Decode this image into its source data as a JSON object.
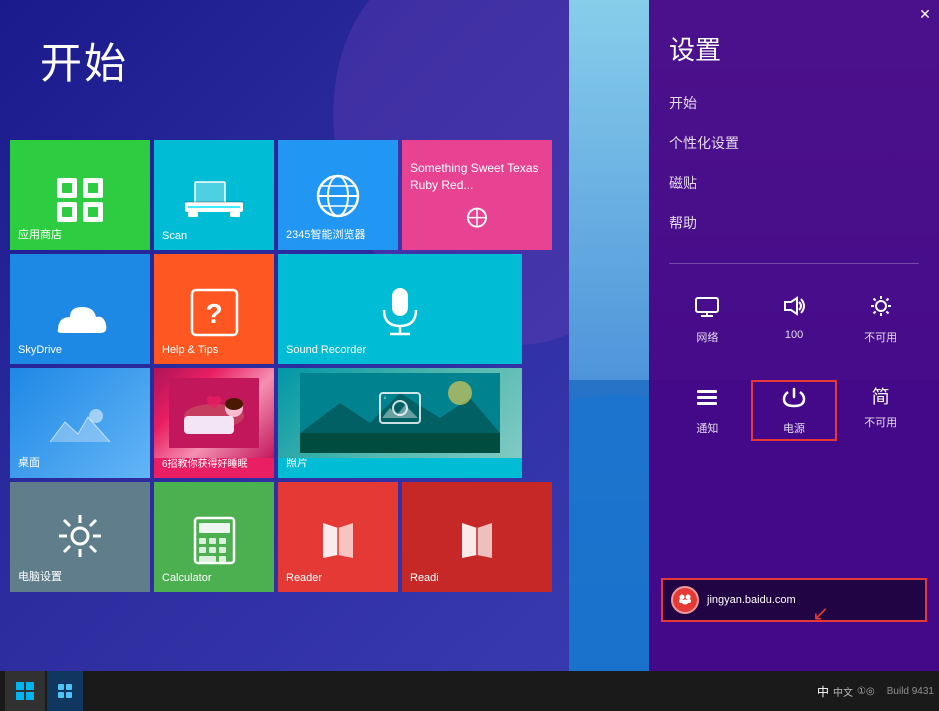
{
  "start": {
    "title": "开始",
    "background_color": "#1a1a8c"
  },
  "settings_panel": {
    "title": "设置",
    "items": [
      {
        "id": "start",
        "label": "开始"
      },
      {
        "id": "personalize",
        "label": "个性化设置"
      },
      {
        "id": "tiles",
        "label": "磁贴"
      },
      {
        "id": "help",
        "label": "帮助"
      }
    ],
    "icons_row1": [
      {
        "id": "network",
        "symbol": "🖥",
        "label": "网络"
      },
      {
        "id": "volume",
        "symbol": "🔊",
        "label": "100"
      },
      {
        "id": "brightness",
        "symbol": "☀",
        "label": "不可用"
      }
    ],
    "icons_row2": [
      {
        "id": "notification",
        "symbol": "≡",
        "label": "通知"
      },
      {
        "id": "power",
        "symbol": "⏻",
        "label": "电源"
      },
      {
        "id": "language",
        "symbol": "简",
        "label": "不可用"
      }
    ]
  },
  "tiles": [
    {
      "id": "appstore",
      "label": "应用商店",
      "color": "#2ecc40"
    },
    {
      "id": "scan",
      "label": "Scan",
      "color": "#00bcd4"
    },
    {
      "id": "browser",
      "label": "2345智能浏览器",
      "color": "#2196f3"
    },
    {
      "id": "food",
      "label": "Something Sweet Texas Ruby Red...",
      "color": "#e84393"
    },
    {
      "id": "skydrive",
      "label": "SkyDrive",
      "color": "#1e88e5"
    },
    {
      "id": "help-tips",
      "label": "Help & Tips",
      "color": "#ff5722"
    },
    {
      "id": "sound",
      "label": "Sound Recorder",
      "color": "#00bcd4"
    },
    {
      "id": "desktop",
      "label": "桌面",
      "color": "#1e88e5"
    },
    {
      "id": "health",
      "label": "6招教你获得好睡眠",
      "color": "#e91e63"
    },
    {
      "id": "photo",
      "label": "照片",
      "color": "#00bcd4"
    },
    {
      "id": "pc-settings",
      "label": "电脑设置",
      "color": "#607d8b"
    },
    {
      "id": "calculator",
      "label": "Calculator",
      "color": "#4caf50"
    },
    {
      "id": "reader",
      "label": "Reader",
      "color": "#e53935"
    },
    {
      "id": "reader2",
      "label": "Readi",
      "color": "#c62828"
    }
  ],
  "taskbar": {
    "right_text": "中文",
    "build_info": "Build 9431",
    "time_area": "图中·①·◎"
  },
  "watermark": {
    "site": "jingyan.baidu.com",
    "paw_text": "🐾"
  },
  "close_btn": "✕"
}
